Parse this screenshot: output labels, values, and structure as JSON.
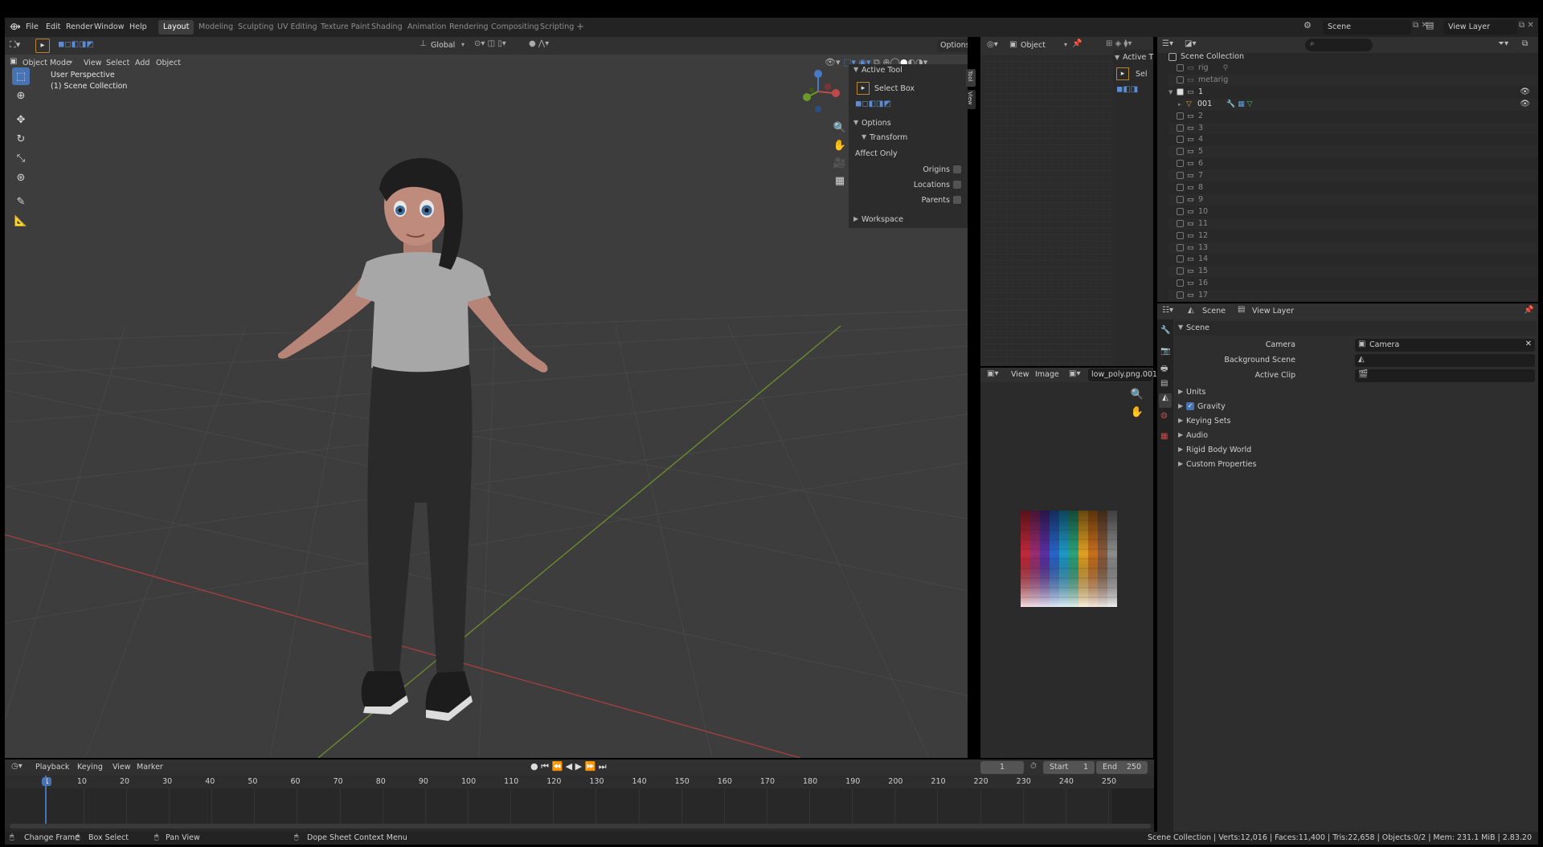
{
  "menu": {
    "items": [
      "File",
      "Edit",
      "Render",
      "Window",
      "Help"
    ]
  },
  "workspaces": [
    "Layout",
    "Modeling",
    "Sculpting",
    "UV Editing",
    "Texture Paint",
    "Shading",
    "Animation",
    "Rendering",
    "Compositing",
    "Scripting"
  ],
  "active_workspace": "Layout",
  "topbar": {
    "scene": "Scene",
    "view_layer": "View Layer"
  },
  "viewport": {
    "mode": "Object Mode",
    "menus": [
      "View",
      "Select",
      "Add",
      "Object"
    ],
    "orientation": "Global",
    "options_label": "Options",
    "perspective": "User Perspective",
    "collection": "(1) Scene Collection",
    "sidebar_tabs": [
      "Tool",
      "View"
    ],
    "active_tool_header": "Active Tool",
    "tool_name": "Select Box",
    "options_header": "Options",
    "transform_header": "Transform",
    "affect_only": "Affect Only",
    "origins": "Origins",
    "locations": "Locations",
    "parents": "Parents",
    "workspace_header": "Workspace",
    "gizmo": {
      "x": "X",
      "y": "Y",
      "z": "Z"
    }
  },
  "uv_editor": {
    "object_mode": "Object",
    "active_tool": "Active T",
    "tool_short": "Sel"
  },
  "image_editor": {
    "menus": [
      "View",
      "Image"
    ],
    "image_name": "low_poly.png.001"
  },
  "outliner": {
    "root": "Scene Collection",
    "rows": [
      "rig",
      "metarig",
      "1",
      "001",
      "2",
      "3",
      "4",
      "5",
      "6",
      "7",
      "8",
      "9",
      "10",
      "11",
      "12",
      "13",
      "14",
      "15",
      "16",
      "17"
    ]
  },
  "properties": {
    "scene_tab": "Scene",
    "view_layer_tab": "View Layer",
    "section": "Scene",
    "camera_label": "Camera",
    "camera_value": "Camera",
    "background_scene_label": "Background Scene",
    "active_clip_label": "Active Clip",
    "subsections": [
      "Units",
      "Gravity",
      "Keying Sets",
      "Audio",
      "Rigid Body World",
      "Custom Properties"
    ]
  },
  "timeline": {
    "menus": [
      "Playback",
      "Keying",
      "View",
      "Marker"
    ],
    "current_frame": "1",
    "start_label": "Start",
    "start": "1",
    "end_label": "End",
    "end": "250",
    "ticks": [
      "1",
      "10",
      "20",
      "30",
      "40",
      "50",
      "60",
      "70",
      "80",
      "90",
      "100",
      "110",
      "120",
      "130",
      "140",
      "150",
      "160",
      "170",
      "180",
      "190",
      "200",
      "210",
      "220",
      "230",
      "240",
      "250"
    ]
  },
  "statusbar": {
    "change_frame": "Change Frame",
    "box_select": "Box Select",
    "pan_view": "Pan View",
    "context_menu": "Dope Sheet Context Menu",
    "stats": "Scene Collection | Verts:12,016 | Faces:11,400 | Tris:22,658 | Objects:0/2 | Mem: 231.1 MiB | 2.83.20"
  },
  "colors": {
    "accent": "#4772b3",
    "x_axis": "#a93e3e",
    "y_axis": "#6e8f2c",
    "header": "#303030",
    "viewport_bg": "#3d3d3d"
  }
}
